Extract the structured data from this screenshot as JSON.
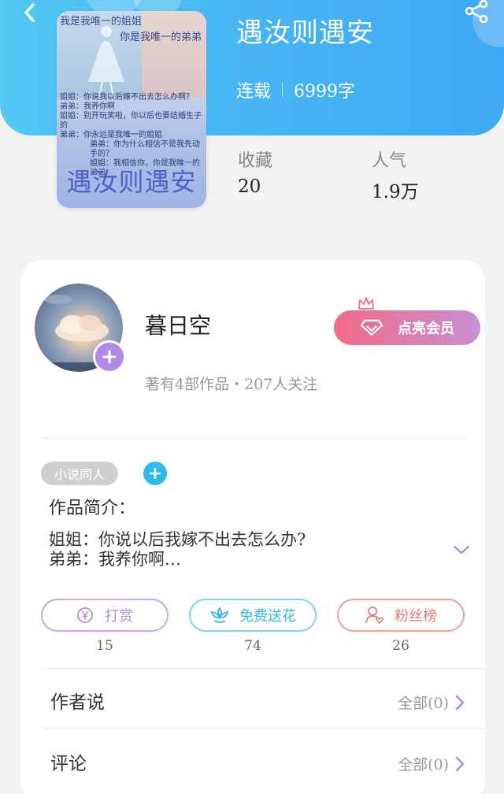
{
  "book": {
    "title": "遇汝则遇安",
    "status": "连载",
    "word_count": "6999字",
    "cover": {
      "line1": "我是我唯一的姐姐",
      "line2": "你是我唯一的弟弟",
      "dialog": [
        "姐姐：你说我以后嫁不出去怎么办啊？",
        "弟弟：我养你啊",
        "姐姐：别开玩笑啦，你以后也要结婚生子的",
        "弟弟：你永远是我唯一的姐姐",
        "弟弟：你为什么相信不是我先动手的？",
        "姐姐：我相信你，你是我唯一的弟弟"
      ],
      "title": "遇汝则遇安"
    },
    "stats": {
      "favorites_label": "收藏",
      "favorites_value": "20",
      "popularity_label": "人气",
      "popularity_value": "1.9万"
    }
  },
  "author": {
    "name": "暮日空",
    "stats": "著有4部作品・207人关注",
    "vip_label": "点亮会员"
  },
  "tags": [
    "小说同人"
  ],
  "intro": {
    "heading": "作品简介：",
    "line1": "姐姐：你说以后我嫁不出去怎么办?",
    "line2": "弟弟：我养你啊…"
  },
  "actions": [
    {
      "label": "打赏",
      "count": "15",
      "color": "#b48ed8"
    },
    {
      "label": "免费送花",
      "count": "74",
      "color": "#2fbbe8"
    },
    {
      "label": "粉丝榜",
      "count": "26",
      "color": "#e17a7a"
    }
  ],
  "sections": {
    "author_says": {
      "title": "作者说",
      "link": "全部(0)"
    },
    "comments": {
      "title": "评论",
      "link": "全部(0)"
    }
  },
  "colors": {
    "header_blue": "#45b2f4",
    "accent_purple": "#b28ae6"
  },
  "icons": {
    "back": "chevron-left-icon",
    "share": "share-icon",
    "vip": "diamond-icon",
    "crown": "crown-icon"
  }
}
